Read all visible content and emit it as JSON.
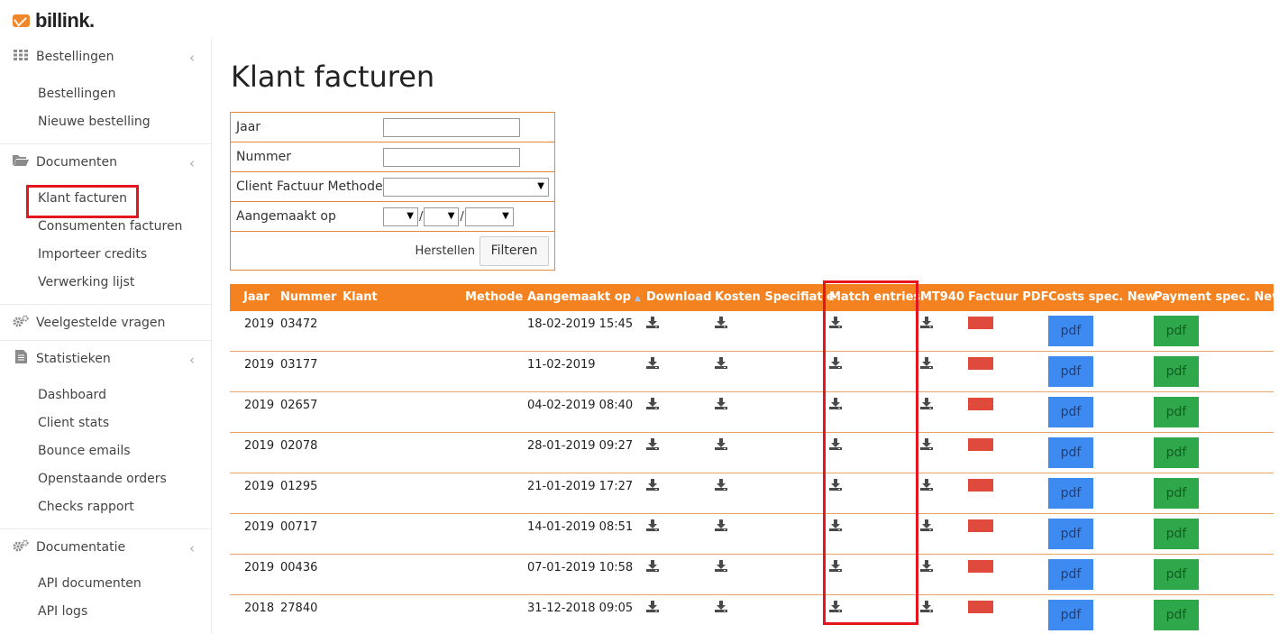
{
  "brand": {
    "name": "billink.",
    "accent": "#f58220"
  },
  "sidebar": {
    "sections": [
      {
        "label": "Bestellingen",
        "icon": "grid-icon",
        "items": [
          "Bestellingen",
          "Nieuwe bestelling"
        ]
      },
      {
        "label": "Documenten",
        "icon": "folder-open-icon",
        "items": [
          "Klant facturen",
          "Consumenten facturen",
          "Importeer credits",
          "Verwerking lijst"
        ]
      },
      {
        "label": "Veelgestelde vragen",
        "icon": "gears-icon",
        "items": []
      },
      {
        "label": "Statistieken",
        "icon": "document-icon",
        "items": [
          "Dashboard",
          "Client stats",
          "Bounce emails",
          "Openstaande orders",
          "Checks rapport"
        ]
      },
      {
        "label": "Documentatie",
        "icon": "gears-icon",
        "items": [
          "API documenten",
          "API logs"
        ]
      }
    ],
    "active_item": "Klant facturen"
  },
  "page": {
    "title": "Klant facturen"
  },
  "filter": {
    "year_label": "Jaar",
    "number_label": "Nummer",
    "method_label": "Client Factuur Methode",
    "created_label": "Aangemaakt op",
    "reset_label": "Herstellen",
    "submit_label": "Filteren",
    "year_value": "",
    "number_value": ""
  },
  "table": {
    "headers": {
      "jaar": "Jaar",
      "nummer": "Nummer",
      "klant": "Klant",
      "methode": "Methode",
      "aangemaakt": "Aangemaakt op",
      "download": "Download",
      "kosten": "Kosten Specifiatie",
      "match": "Match entries",
      "mt940": "MT940",
      "factuur": "Factuur PDF",
      "costs_new": "Costs spec. New",
      "payment_new": "Payment spec. New"
    },
    "pdf_label": "pdf",
    "rows": [
      {
        "jaar": "2019",
        "nummer": "03472",
        "aangemaakt": "18-02-2019 15:45"
      },
      {
        "jaar": "2019",
        "nummer": "03177",
        "aangemaakt": "11-02-2019"
      },
      {
        "jaar": "2019",
        "nummer": "02657",
        "aangemaakt": "04-02-2019 08:40"
      },
      {
        "jaar": "2019",
        "nummer": "02078",
        "aangemaakt": "28-01-2019 09:27"
      },
      {
        "jaar": "2019",
        "nummer": "01295",
        "aangemaakt": "21-01-2019 17:27"
      },
      {
        "jaar": "2019",
        "nummer": "00717",
        "aangemaakt": "14-01-2019 08:51"
      },
      {
        "jaar": "2019",
        "nummer": "00436",
        "aangemaakt": "07-01-2019 10:58"
      },
      {
        "jaar": "2018",
        "nummer": "27840",
        "aangemaakt": "31-12-2018 09:05"
      }
    ]
  },
  "colors": {
    "header_bg": "#f58220",
    "pdf_blue": "#3d8bf0",
    "pdf_green": "#2ea84a",
    "factuur_red": "#e04a3c",
    "highlight": "#e4151c"
  }
}
